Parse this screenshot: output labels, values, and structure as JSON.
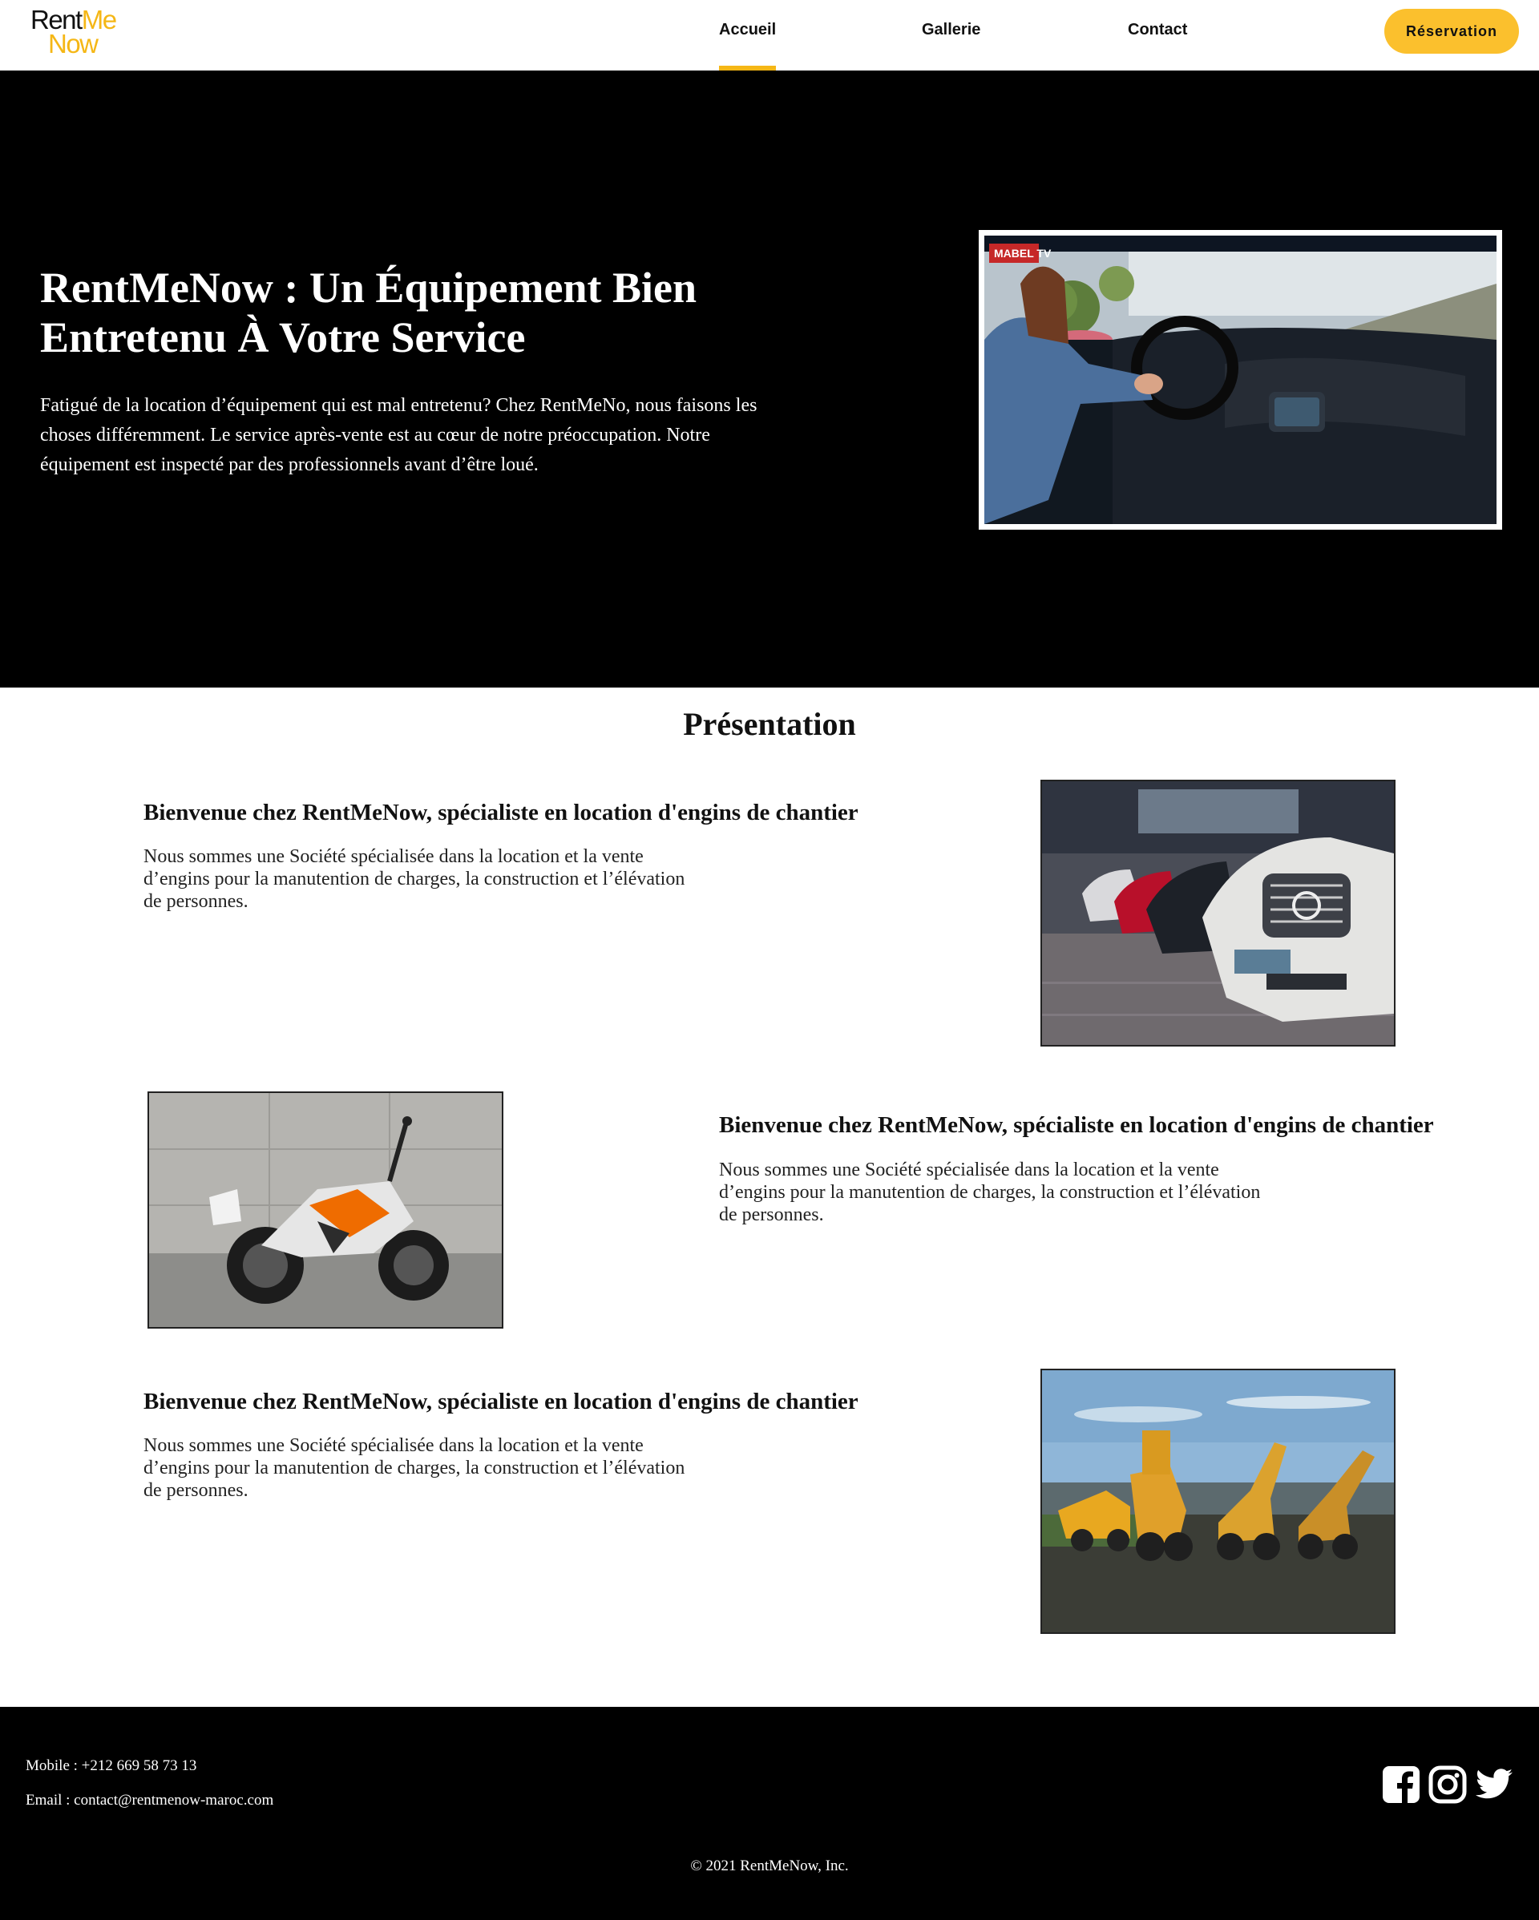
{
  "logo": {
    "line1_a": "Rent",
    "line1_b": "Me",
    "line2": "Now"
  },
  "nav": {
    "items": [
      {
        "label": "Accueil",
        "active": true
      },
      {
        "label": "Gallerie",
        "active": false
      },
      {
        "label": "Contact",
        "active": false
      }
    ],
    "cta_label": "Réservation"
  },
  "hero": {
    "title": "RentMeNow : Un Équipement Bien Entretenu À Votre Service",
    "text": "Fatigué de la location d’équipement qui est mal entretenu? Chez RentMeNo, nous faisons les choses différemment. Le service après-vente est au cœur de notre préoccupation. Notre équipement est inspecté par des professionnels avant d’être loué.",
    "video_brand": "MABEL TV"
  },
  "presentation": {
    "title": "Présentation",
    "features": [
      {
        "title": "Bienvenue chez RentMeNow, spécialiste en location d'engins de chantier",
        "text": "Nous sommes une Société spécialisée dans la location et la vente d’engins pour la manutention de charges, la construction et l’élévation de personnes.",
        "image": "parked-cars-photo"
      },
      {
        "title": "Bienvenue chez RentMeNow, spécialiste en location d'engins de chantier",
        "text": "Nous sommes une Société spécialisée dans la location et la vente d’engins pour la manutention de charges, la construction et l’élévation de personnes.",
        "image": "motorcycle-photo"
      },
      {
        "title": "Bienvenue chez RentMeNow, spécialiste en location d'engins de chantier",
        "text": "Nous sommes une Société spécialisée dans la location et la vente d’engins pour la manutention de charges, la construction et l’élévation de personnes.",
        "image": "construction-machines-photo"
      }
    ]
  },
  "footer": {
    "mobile": "Mobile : +212 669 58 73 13",
    "email": "Email : contact@rentmenow-maroc.com",
    "copyright": "© 2021 RentMeNow, Inc.",
    "social": [
      "facebook-icon",
      "instagram-icon",
      "twitter-icon"
    ]
  },
  "colors": {
    "accent": "#fbc02d",
    "hero_bg": "#000000",
    "footer_bg": "#000000"
  }
}
